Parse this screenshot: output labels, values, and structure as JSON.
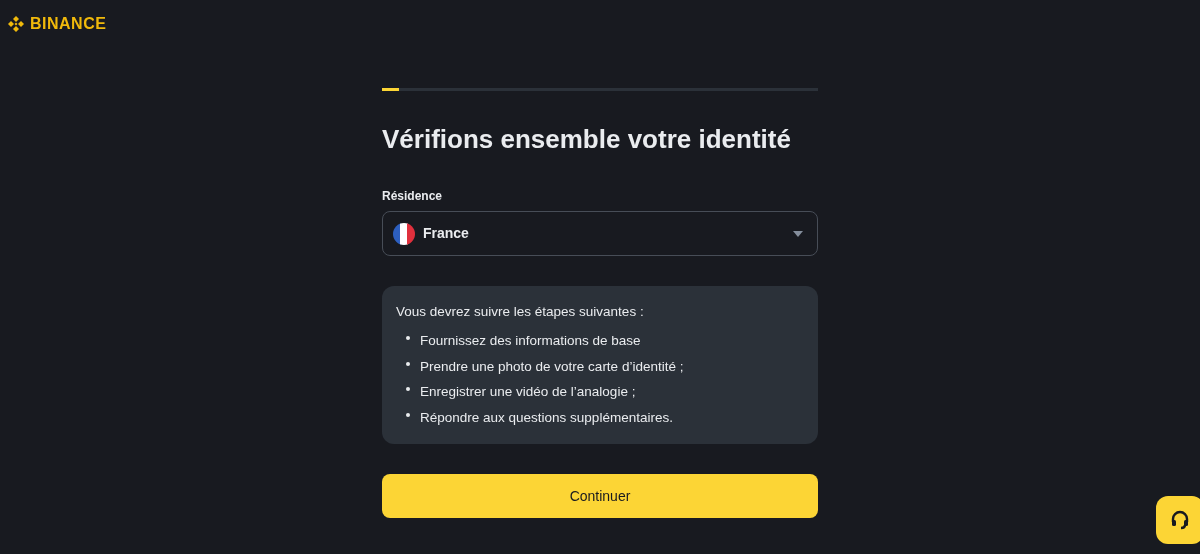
{
  "header": {
    "logo_text": "BINANCE"
  },
  "progress": {
    "level": 0.04
  },
  "title": "Vérifions ensemble votre identité",
  "residence": {
    "label": "Résidence",
    "value": "France"
  },
  "steps": {
    "intro": "Vous devrez suivre les étapes suivantes :",
    "items": [
      "Fournissez des informations de base",
      "Prendre une photo de votre carte d’identité ;",
      "Enregistrer une vidéo de l’analogie ;",
      "Répondre aux questions supplémentaires."
    ]
  },
  "continue_button": "Continuer"
}
